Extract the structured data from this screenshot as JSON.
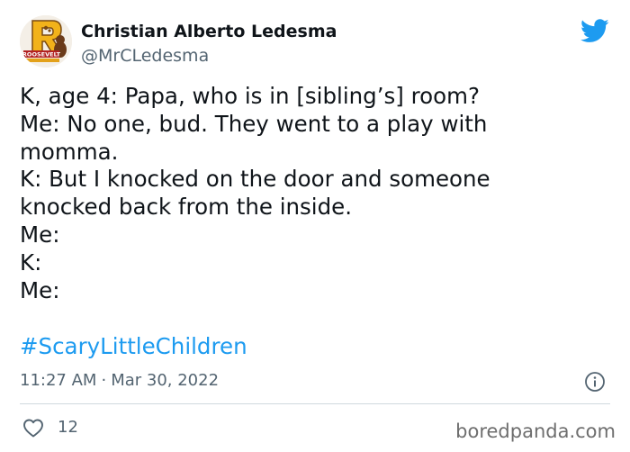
{
  "author": {
    "name": "Christian Alberto Ledesma",
    "handle": "@MrCLedesma",
    "avatar_text": "ROOSEVELT"
  },
  "tweet": {
    "lines": [
      "K, age 4: Papa, who is in [sibling’s] room?",
      "Me: No one, bud. They went to a play with",
      "momma.",
      "K: But I knocked on the door and someone",
      "knocked back from the inside.",
      "Me:",
      "K:",
      "Me:"
    ],
    "hashtag": "#ScaryLittleChildren",
    "time": "11:27 AM",
    "separator": "·",
    "date": "Mar 30, 2022",
    "like_count": "12"
  },
  "watermark": "boredpanda.com",
  "colors": {
    "text": "#0f1419",
    "secondary": "#536471",
    "twitter_blue": "#1d9bf0",
    "divider": "#cfd9de"
  },
  "icons": {
    "platform": "twitter-bird-icon",
    "info": "info-icon",
    "like": "heart-icon"
  }
}
